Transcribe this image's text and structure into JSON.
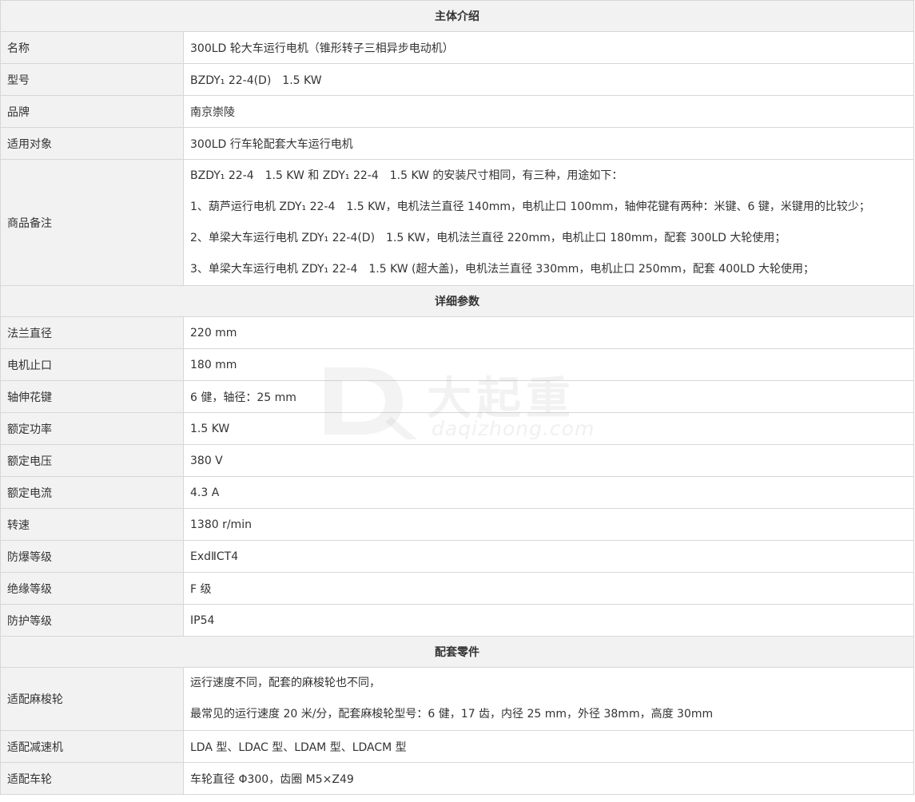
{
  "sections": {
    "intro": "主体介绍",
    "params": "详细参数",
    "parts": "配套零件"
  },
  "intro_rows": [
    {
      "label": "名称",
      "value": "300LD 轮大车运行电机（锥形转子三相异步电动机）"
    },
    {
      "label": "型号",
      "value": "BZDY₁ 22-4(D)　1.5 KW"
    },
    {
      "label": "品牌",
      "value": "南京崇陵"
    },
    {
      "label": "适用对象",
      "value": "300LD 行车轮配套大车运行电机"
    },
    {
      "label": "商品备注",
      "lines": [
        "BZDY₁ 22-4　1.5 KW 和 ZDY₁ 22-4　1.5 KW 的安装尺寸相同，有三种，用途如下：",
        "1、葫芦运行电机 ZDY₁ 22-4　1.5 KW，电机法兰直径 140mm，电机止口 100mm，轴伸花键有两种：米键、6 键，米键用的比较少；",
        "2、单梁大车运行电机 ZDY₁ 22-4(D)　1.5 KW，电机法兰直径 220mm，电机止口 180mm，配套 300LD 大轮使用；",
        "3、单梁大车运行电机 ZDY₁ 22-4　1.5 KW (超大盖)，电机法兰直径 330mm，电机止口 250mm，配套 400LD 大轮使用；"
      ]
    }
  ],
  "param_rows": [
    {
      "label": "法兰直径",
      "value": "220 mm"
    },
    {
      "label": "电机止口",
      "value": "180 mm"
    },
    {
      "label": "轴伸花键",
      "value": "6 健，轴径：25 mm"
    },
    {
      "label": "额定功率",
      "value": "1.5 KW"
    },
    {
      "label": "额定电压",
      "value": "380 V"
    },
    {
      "label": "额定电流",
      "value": "4.3 A"
    },
    {
      "label": "转速",
      "value": "1380 r/min"
    },
    {
      "label": "防爆等级",
      "value": "ExdⅡCT4"
    },
    {
      "label": "绝缘等级",
      "value": "F 级"
    },
    {
      "label": "防护等级",
      "value": "IP54"
    }
  ],
  "part_rows": [
    {
      "label": "适配麻梭轮",
      "lines": [
        "运行速度不同，配套的麻梭轮也不同，",
        "最常见的运行速度 20 米/分，配套麻梭轮型号：6 健，17 齿，内径 25 mm，外径 38mm，高度 30mm"
      ]
    },
    {
      "label": "适配减速机",
      "value": "LDA 型、LDAC 型、LDAM 型、LDACM 型"
    },
    {
      "label": "适配车轮",
      "value": "车轮直径 Φ300，齿圈 M5×Z49"
    }
  ],
  "watermark": {
    "cn": "大起重",
    "url": "daqizhong.com"
  }
}
